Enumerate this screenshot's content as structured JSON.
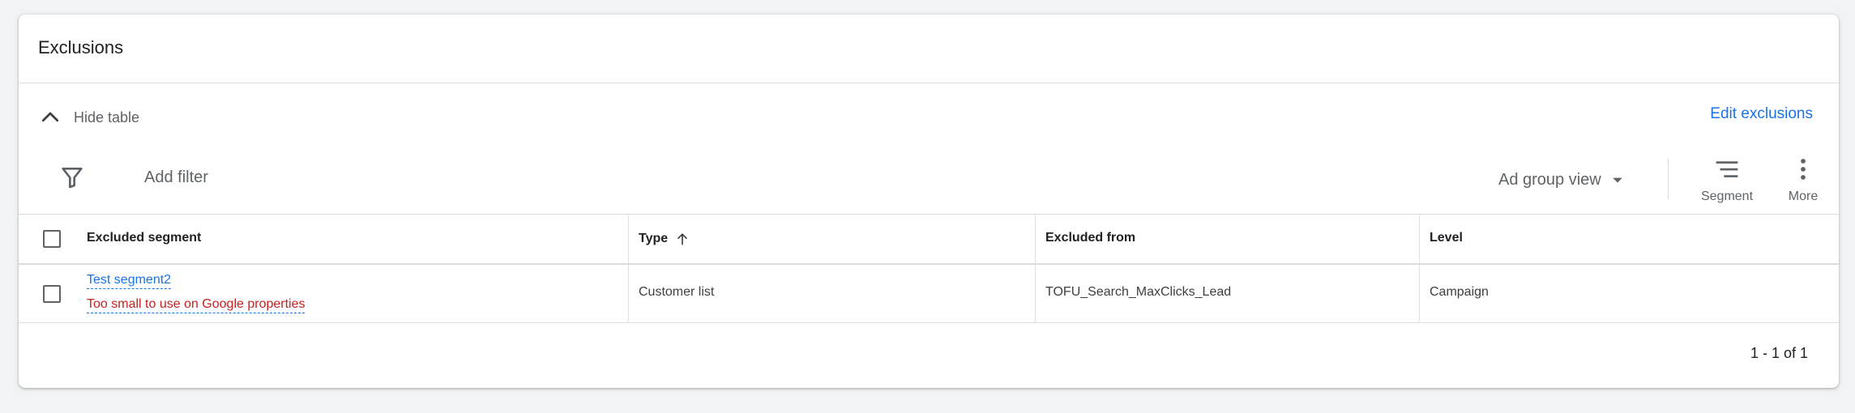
{
  "card": {
    "title": "Exclusions",
    "hide_table_label": "Hide table",
    "edit_exclusions_label": "Edit exclusions"
  },
  "toolbar": {
    "add_filter_label": "Add filter",
    "view_selector_label": "Ad group view",
    "segment_label": "Segment",
    "more_label": "More"
  },
  "table": {
    "columns": {
      "excluded_segment": "Excluded segment",
      "type": "Type",
      "excluded_from": "Excluded from",
      "level": "Level"
    },
    "sort": {
      "column": "Type",
      "direction": "ascending"
    },
    "rows": [
      {
        "segment": "Test segment2",
        "warning": "Too small to use on Google properties",
        "type": "Customer list",
        "excluded_from": "TOFU_Search_MaxClicks_Lead",
        "level": "Campaign"
      }
    ]
  },
  "pagination": {
    "text": "1 - 1 of 1"
  },
  "colors": {
    "link": "#1a73e8",
    "warning": "#c5221f",
    "text_secondary": "#5f6368",
    "divider": "#dadce0"
  },
  "icons": {
    "hide": "chevron-up-icon",
    "filter": "filter-icon",
    "dropdown": "arrow-drop-down-icon",
    "segment": "segment-lines-icon",
    "more": "more-vert-icon",
    "sort": "arrow-up-icon"
  }
}
